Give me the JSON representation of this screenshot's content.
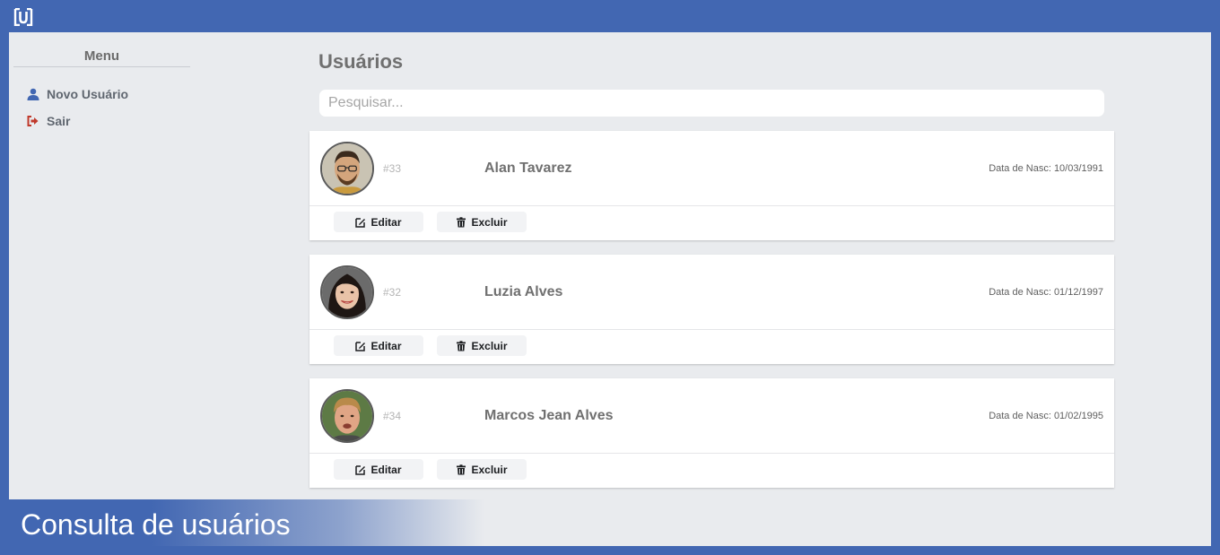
{
  "app": {
    "logo_icon": "bracket-u-logo-icon"
  },
  "sidebar": {
    "title": "Menu",
    "items": [
      {
        "label": "Novo Usuário",
        "icon": "user-icon",
        "color": "#4267b2"
      },
      {
        "label": "Sair",
        "icon": "sign-out-icon",
        "color": "#c0392b"
      }
    ]
  },
  "main": {
    "title": "Usuários",
    "search": {
      "placeholder": "Pesquisar...",
      "value": ""
    },
    "users": [
      {
        "id": "#33",
        "name": "Alan Tavarez",
        "dob": "Data de Nasc: 10/03/1991",
        "edit_label": "Editar",
        "delete_label": "Excluir"
      },
      {
        "id": "#32",
        "name": "Luzia Alves",
        "dob": "Data de Nasc: 01/12/1997",
        "edit_label": "Editar",
        "delete_label": "Excluir"
      },
      {
        "id": "#34",
        "name": "Marcos Jean Alves",
        "dob": "Data de Nasc: 01/02/1995",
        "edit_label": "Editar",
        "delete_label": "Excluir"
      }
    ]
  },
  "caption": "Consulta de usuários",
  "colors": {
    "brand": "#4267b2",
    "background": "#e9ebee"
  }
}
